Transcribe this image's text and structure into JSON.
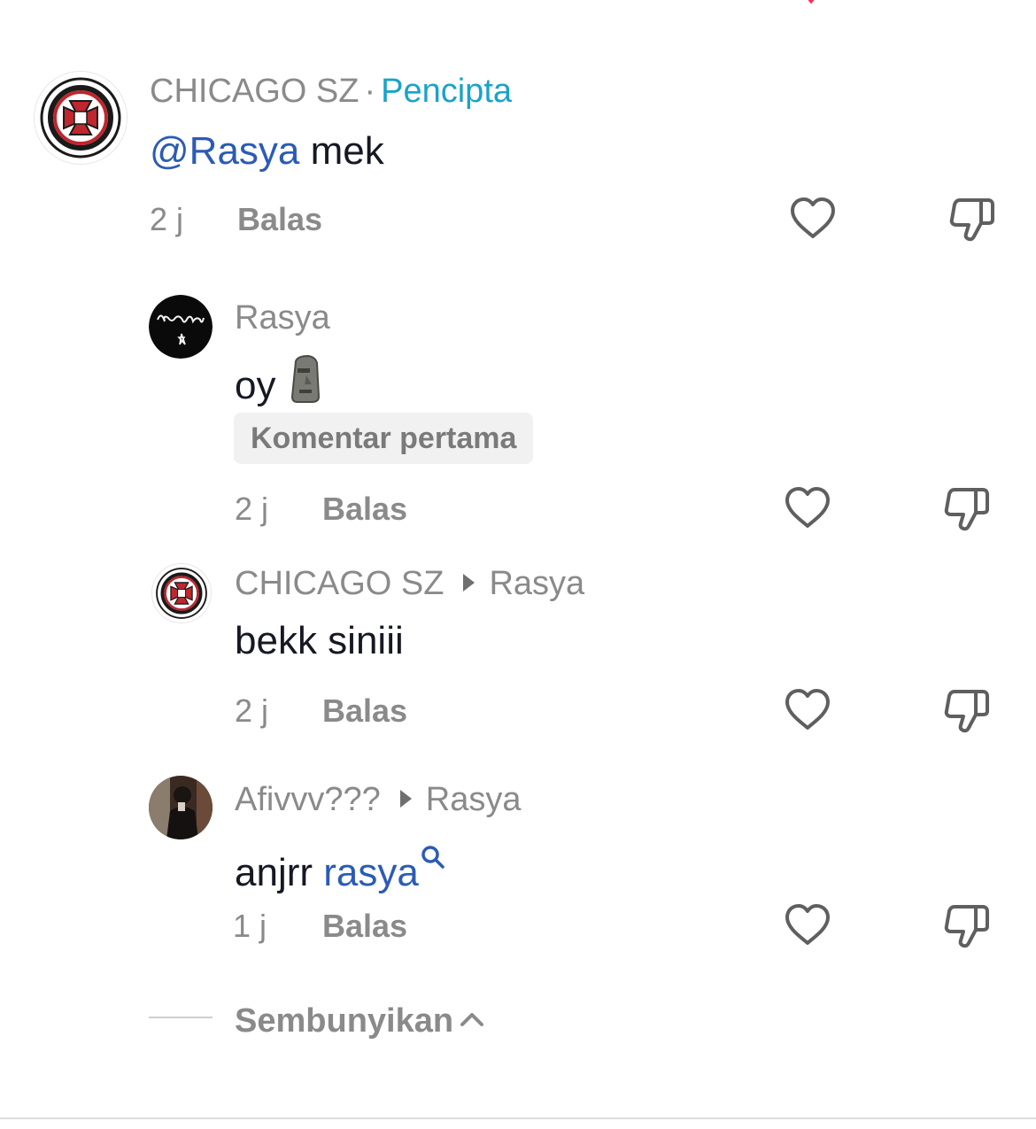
{
  "colors": {
    "username": "#8a8a8a",
    "creator_badge": "#1aa3c9",
    "mention": "#2b5bb5",
    "text": "#161823",
    "pill_bg": "#f1f1f2"
  },
  "comment": {
    "username": "CHICAGO SZ",
    "separator": "·",
    "creator_label": "Pencipta",
    "mention": "@Rasya",
    "text": "mek",
    "time": "2 j",
    "reply_label": "Balas",
    "avatar_icon": "chicago-logo-avatar"
  },
  "replies": [
    {
      "username": "Rasya",
      "text": "oy",
      "emoji": "🗿",
      "badge": "Komentar pertama",
      "time": "2 j",
      "reply_label": "Balas",
      "avatar_icon": "rasya-signature-avatar"
    },
    {
      "username": "CHICAGO SZ",
      "reply_to": "Rasya",
      "text": "bekk siniii",
      "time": "2 j",
      "reply_label": "Balas",
      "avatar_icon": "chicago-logo-avatar"
    },
    {
      "username": "Afivvv???",
      "reply_to": "Rasya",
      "text": "anjrr",
      "search_term": "rasya",
      "time": "1 j",
      "reply_label": "Balas",
      "avatar_icon": "photo-avatar"
    }
  ],
  "hide_label": "Sembunyikan",
  "icons": {
    "like": "heart-icon",
    "dislike": "thumbs-down-icon",
    "search": "search-icon",
    "collapse": "chevron-up-icon"
  }
}
